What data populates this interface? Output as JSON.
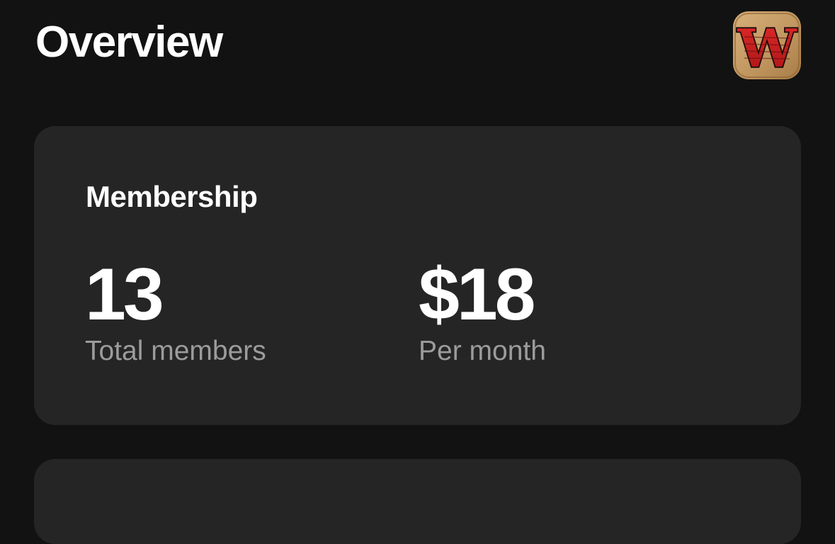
{
  "header": {
    "title": "Overview",
    "avatar_icon": "club-logo-w-icon",
    "avatar_letter": "W"
  },
  "membership": {
    "title": "Membership",
    "stats": [
      {
        "value": "13",
        "label": "Total members"
      },
      {
        "value": "$18",
        "label": "Per month"
      }
    ]
  },
  "colors": {
    "background": "#121212",
    "card": "#252525",
    "label_gray": "#9c9c9c",
    "avatar_red": "#c81e1e",
    "avatar_tan": "#c49a63"
  }
}
